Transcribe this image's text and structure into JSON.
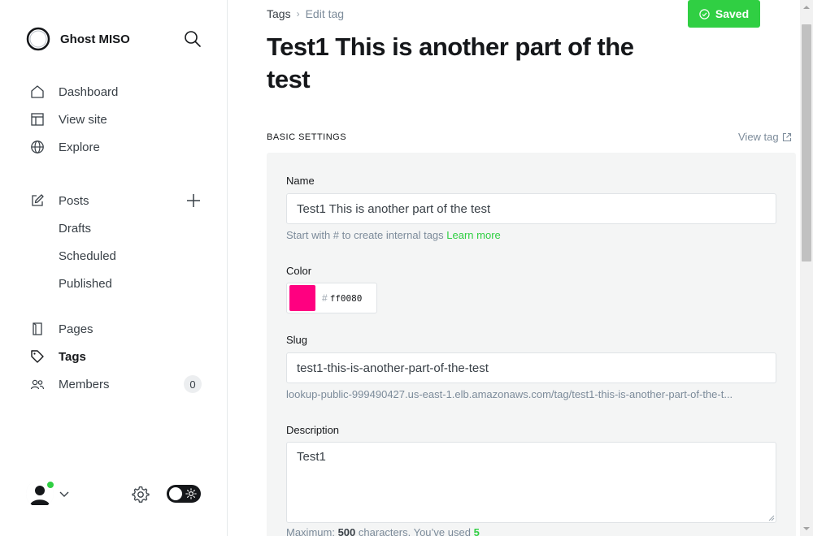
{
  "sidebar": {
    "brand": "Ghost MISO",
    "nav_main": [
      {
        "label": "Dashboard",
        "icon": "home-icon"
      },
      {
        "label": "View site",
        "icon": "layout-icon"
      },
      {
        "label": "Explore",
        "icon": "globe-icon"
      }
    ],
    "posts": {
      "label": "Posts",
      "icon": "edit-icon"
    },
    "post_subitems": [
      {
        "label": "Drafts"
      },
      {
        "label": "Scheduled"
      },
      {
        "label": "Published"
      }
    ],
    "nav_content": [
      {
        "label": "Pages",
        "icon": "page-icon"
      },
      {
        "label": "Tags",
        "icon": "tag-icon"
      },
      {
        "label": "Members",
        "icon": "members-icon",
        "count": "0"
      }
    ],
    "active_item": "Tags"
  },
  "breadcrumb": {
    "parent": "Tags",
    "current": "Edit tag"
  },
  "save_button": {
    "label": "Saved",
    "color": "#30cf43"
  },
  "title": "Test1 This is another part of the test",
  "section": {
    "heading": "BASIC SETTINGS",
    "view_link": "View tag"
  },
  "form": {
    "name_label": "Name",
    "name_value": "Test1 This is another part of the test",
    "name_hint": "Start with # to create internal tags",
    "name_hint_link": "Learn more",
    "color_label": "Color",
    "color_hash": "#",
    "color_value": "ff0080",
    "color_swatch": "#ff0080",
    "slug_label": "Slug",
    "slug_value": "test1-this-is-another-part-of-the-test",
    "slug_url": "lookup-public-999490427.us-east-1.elb.amazonaws.com/tag/test1-this-is-another-part-of-the-t...",
    "description_label": "Description",
    "description_value": "Test1",
    "count_prefix": "Maximum:",
    "count_max": "500",
    "count_mid": "characters. You’ve used",
    "count_used": "5"
  }
}
